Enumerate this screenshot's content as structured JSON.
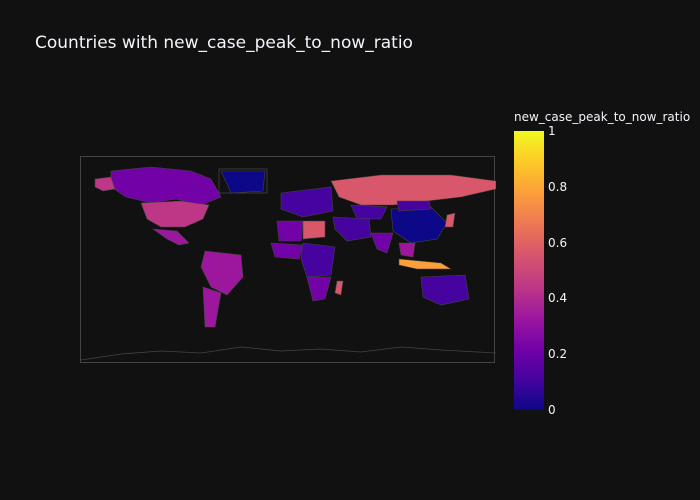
{
  "title": "Countries with new_case_peak_to_now_ratio",
  "colorbar": {
    "title": "new_case_peak_to_now_ratio",
    "ticks": [
      {
        "label": "1",
        "value": 1.0
      },
      {
        "label": "0.8",
        "value": 0.8
      },
      {
        "label": "0.6",
        "value": 0.6
      },
      {
        "label": "0.4",
        "value": 0.4
      },
      {
        "label": "0.2",
        "value": 0.2
      },
      {
        "label": "0",
        "value": 0.0
      }
    ],
    "colorscale": [
      "#0d0887",
      "#46039f",
      "#7201a8",
      "#9c179e",
      "#bd3786",
      "#d8576b",
      "#ed7953",
      "#fb9f3a",
      "#fdca26",
      "#f0f921"
    ]
  },
  "map": {
    "projection": "equirectangular",
    "background": "#111111",
    "coastline_color": "#444444",
    "regions": [
      {
        "name": "Canada",
        "value": 0.27
      },
      {
        "name": "Alaska",
        "value": 0.45
      },
      {
        "name": "United States",
        "value": 0.42
      },
      {
        "name": "Mexico",
        "value": 0.3
      },
      {
        "name": "Brazil",
        "value": 0.32
      },
      {
        "name": "Argentina",
        "value": 0.3
      },
      {
        "name": "Russia",
        "value": 0.55
      },
      {
        "name": "China",
        "value": 0.05
      },
      {
        "name": "Mongolia",
        "value": 0.06
      },
      {
        "name": "Kazakhstan",
        "value": 0.1
      },
      {
        "name": "India",
        "value": 0.25
      },
      {
        "name": "Australia",
        "value": 0.06
      },
      {
        "name": "Indonesia",
        "value": 0.82
      },
      {
        "name": "Southeast Asia",
        "value": 0.3
      },
      {
        "name": "Europe",
        "value": 0.15
      },
      {
        "name": "North Africa",
        "value": 0.18
      },
      {
        "name": "Libya",
        "value": 0.5
      },
      {
        "name": "West Africa",
        "value": 0.25
      },
      {
        "name": "Central Africa",
        "value": 0.12
      },
      {
        "name": "Southern Africa",
        "value": 0.25
      },
      {
        "name": "Madagascar",
        "value": 0.55
      },
      {
        "name": "Middle East",
        "value": 0.12
      },
      {
        "name": "Japan",
        "value": 0.55
      },
      {
        "name": "Greenland",
        "value": 0.0
      }
    ]
  }
}
